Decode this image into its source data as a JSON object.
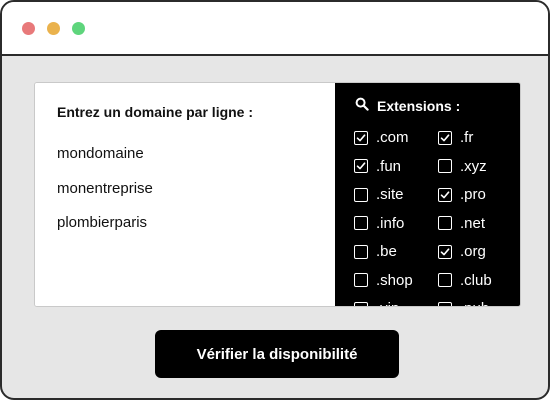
{
  "form": {
    "prompt": "Entrez un domaine par ligne :",
    "domains": [
      "mondomaine",
      "monentreprise",
      "plombierparis"
    ]
  },
  "extensions": {
    "title": "Extensions :",
    "icon": "search-icon",
    "items": [
      {
        "label": ".com",
        "checked": true
      },
      {
        "label": ".fr",
        "checked": true
      },
      {
        "label": ".fun",
        "checked": true
      },
      {
        "label": ".xyz",
        "checked": false
      },
      {
        "label": ".site",
        "checked": false
      },
      {
        "label": ".pro",
        "checked": true
      },
      {
        "label": ".info",
        "checked": false
      },
      {
        "label": ".net",
        "checked": false
      },
      {
        "label": ".be",
        "checked": false
      },
      {
        "label": ".org",
        "checked": true
      },
      {
        "label": ".shop",
        "checked": false
      },
      {
        "label": ".club",
        "checked": false
      },
      {
        "label": ".vip",
        "checked": false
      },
      {
        "label": ".pub",
        "checked": false
      }
    ]
  },
  "button": {
    "label": "Vérifier la disponibilité"
  },
  "colors": {
    "close_dot": "#e8797a",
    "minimize_dot": "#eab24d",
    "maximize_dot": "#5ed57c",
    "extensions_bg": "#000000",
    "button_bg": "#000000"
  }
}
